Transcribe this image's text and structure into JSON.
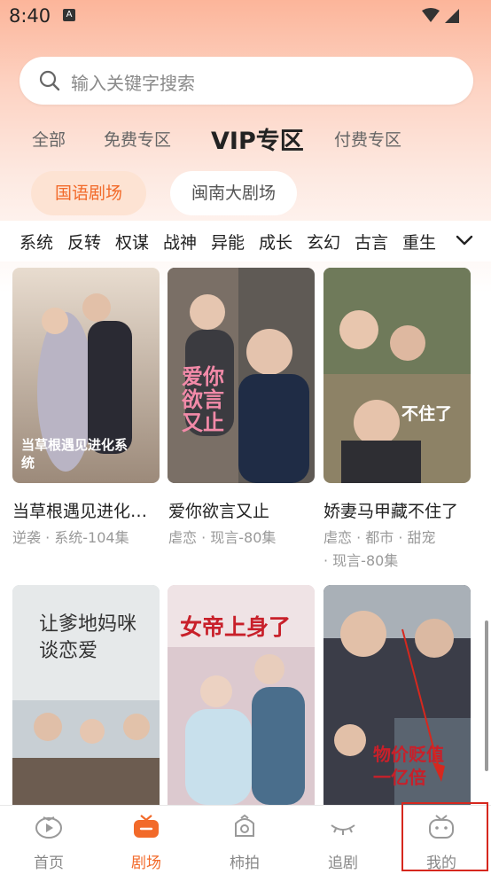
{
  "status": {
    "time": "8:40",
    "notif_glyph": "A"
  },
  "search": {
    "placeholder": "输入关键字搜索"
  },
  "top_tabs": [
    {
      "label": "全部",
      "active": false
    },
    {
      "label": "免费专区",
      "active": false
    },
    {
      "label": "VIP专区",
      "active": true
    },
    {
      "label": "付费专区",
      "active": false
    }
  ],
  "pills": [
    {
      "label": "国语剧场",
      "active": true
    },
    {
      "label": "闽南大剧场",
      "active": false
    }
  ],
  "categories": [
    "系统",
    "反转",
    "权谋",
    "战神",
    "异能",
    "成长",
    "玄幻",
    "古言",
    "重生"
  ],
  "cards": [
    {
      "title": "当草根遇见进化…",
      "tags": "逆袭  ·  系统-104集",
      "poster_text": "当草根遇见进化系统"
    },
    {
      "title": "爱你欲言又止",
      "tags": "虐恋  ·  现言-80集",
      "poster_text": "爱你欲言又止"
    },
    {
      "title": "娇妻马甲藏不住了",
      "tags": "虐恋  ·  都市  ·  甜宠\n·  现言-80集",
      "poster_text": "不住了"
    },
    {
      "title": "",
      "tags": "",
      "poster_text": "让爹地妈咪谈恋爱"
    },
    {
      "title": "",
      "tags": "",
      "poster_text": "女帝上身了"
    },
    {
      "title": "",
      "tags": "",
      "poster_text": "物价贬值一亿倍"
    }
  ],
  "bottom_nav": [
    {
      "label": "首页",
      "icon": "play-blob-icon",
      "active": false
    },
    {
      "label": "剧场",
      "icon": "theater-tv-icon",
      "active": true
    },
    {
      "label": "柿拍",
      "icon": "camera-persimmon-icon",
      "active": false
    },
    {
      "label": "追剧",
      "icon": "eye-lash-icon",
      "active": false
    },
    {
      "label": "我的",
      "icon": "robot-face-icon",
      "active": false
    }
  ],
  "colors": {
    "accent": "#f26a2a",
    "pill_active_bg": "#fde3d3",
    "highlight": "#d6281e"
  }
}
